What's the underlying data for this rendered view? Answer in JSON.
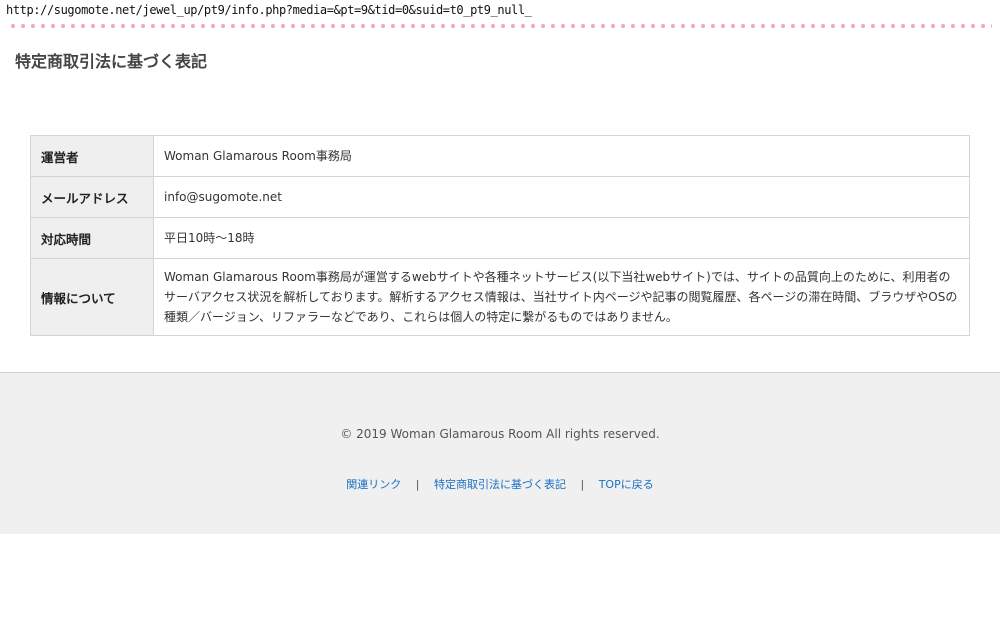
{
  "browser": {
    "url": "http://sugomote.net/jewel_up/pt9/info.php?media=&pt=9&tid=0&suid=t0_pt9_null_"
  },
  "decor": {
    "dot_color": "#f7a8c8"
  },
  "page": {
    "title": "特定商取引法に基づく表記"
  },
  "info_table": {
    "rows": [
      {
        "label": "運営者",
        "value": "Woman Glamarous Room事務局"
      },
      {
        "label": "メールアドレス",
        "value": "info@sugomote.net"
      },
      {
        "label": "対応時間",
        "value": "平日10時～18時"
      },
      {
        "label": "情報について",
        "value": "Woman Glamarous Room事務局が運営するwebサイトや各種ネットサービス(以下当社webサイト)では、サイトの品質向上のために、利用者のサーバアクセス状況を解析しております。解析するアクセス情報は、当社サイト内ページや記事の閲覧履歴、各ページの滞在時間、ブラウザやOSの種類／バージョン、リファラーなどであり、これらは個人の特定に繋がるものではありません。"
      }
    ]
  },
  "footer": {
    "copyright": "© 2019 Woman Glamarous Room All rights reserved.",
    "links": [
      {
        "label": "関連リンク"
      },
      {
        "label": "特定商取引法に基づく表記"
      },
      {
        "label": "TOPに戻る"
      }
    ],
    "separator": "|",
    "link_color": "#1a6fc4"
  }
}
